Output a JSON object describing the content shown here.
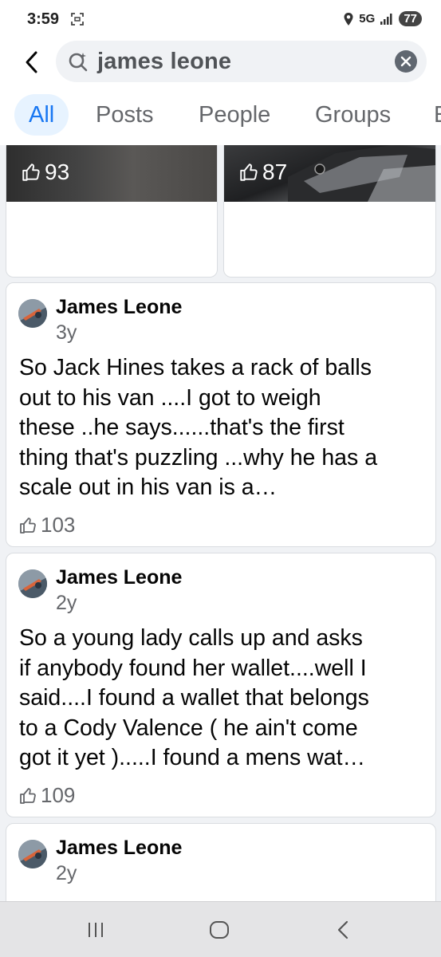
{
  "status_bar": {
    "time": "3:59",
    "network": "5G",
    "battery": "77"
  },
  "search": {
    "query": "james leone",
    "icons": {
      "back": "back-arrow-icon",
      "search": "search-icon",
      "clear": "clear-icon"
    }
  },
  "tabs": [
    {
      "label": "All"
    },
    {
      "label": "Posts"
    },
    {
      "label": "People"
    },
    {
      "label": "Groups"
    },
    {
      "label": "E"
    }
  ],
  "photos": [
    {
      "likes": "93"
    },
    {
      "likes": "87"
    }
  ],
  "posts": [
    {
      "author": "James Leone",
      "time": "3y",
      "lines": [
        "So Jack Hines takes a rack of balls",
        "out to his van ....I got to weigh",
        "these ..he says......that's the first",
        "thing that's puzzling ...why he has a",
        "scale out in his van is a…"
      ],
      "likes": "103"
    },
    {
      "author": "James Leone",
      "time": "2y",
      "lines": [
        "So a young lady calls up and asks",
        "if anybody found her wallet....well I",
        "said....I found a wallet that belongs",
        "to a Cody Valence ( he ain't come",
        "got it yet ).....I found a mens wat…"
      ],
      "likes": "109"
    },
    {
      "author": "James Leone",
      "time": "2y"
    }
  ],
  "colors": {
    "accent": "#1877f2",
    "tab_active_bg": "#e7f3ff",
    "muted": "#65676b"
  }
}
